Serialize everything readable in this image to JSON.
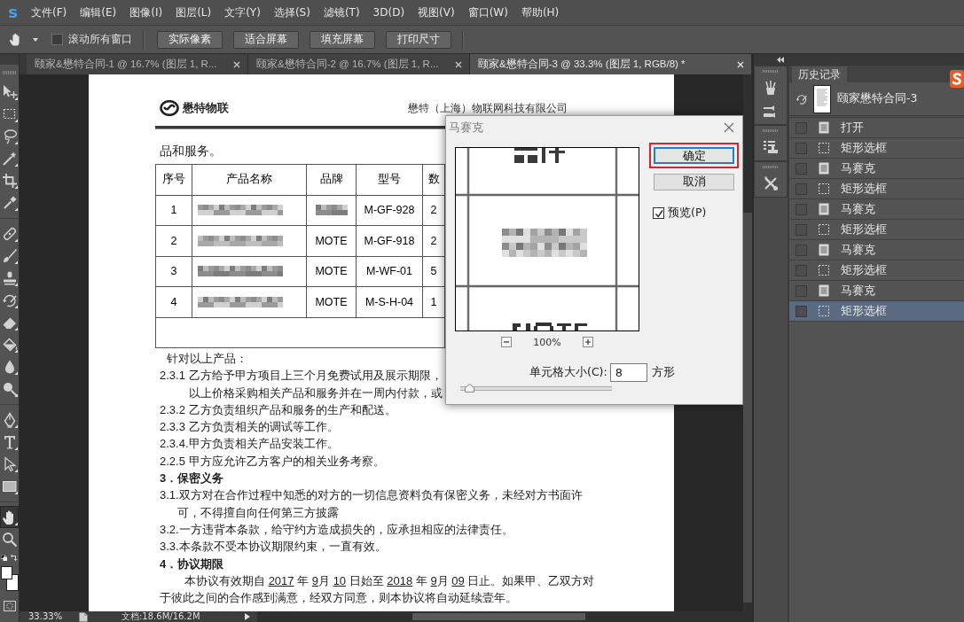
{
  "menu_bar": {
    "logo": "s",
    "items": [
      "文件(F)",
      "编辑(E)",
      "图像(I)",
      "图层(L)",
      "文字(Y)",
      "选择(S)",
      "滤镜(T)",
      "3D(D)",
      "视图(V)",
      "窗口(W)",
      "帮助(H)"
    ]
  },
  "options_bar": {
    "scroll_all": {
      "label": "滚动所有窗口",
      "checked": false
    },
    "buttons": [
      "实际像素",
      "适合屏幕",
      "填充屏幕",
      "打印尺寸"
    ]
  },
  "toolbar": {
    "tool_groups": [
      {
        "tools": [
          {
            "kind": "move",
            "selected": false
          },
          {
            "kind": "marquee",
            "selected": false
          },
          {
            "kind": "lasso",
            "selected": false
          },
          {
            "kind": "wand",
            "selected": false
          },
          {
            "kind": "crop",
            "selected": false
          },
          {
            "kind": "eyedropper",
            "selected": false
          }
        ]
      },
      {
        "tools": [
          {
            "kind": "healing",
            "selected": false
          },
          {
            "kind": "brush",
            "selected": false
          },
          {
            "kind": "stamp",
            "selected": false
          },
          {
            "kind": "history_brush",
            "selected": false
          },
          {
            "kind": "eraser",
            "selected": false
          },
          {
            "kind": "bucket",
            "selected": false
          },
          {
            "kind": "blur",
            "selected": false
          },
          {
            "kind": "dodge",
            "selected": false
          }
        ]
      },
      {
        "tools": [
          {
            "kind": "pen",
            "selected": false
          },
          {
            "kind": "type",
            "selected": false
          },
          {
            "kind": "path_select",
            "selected": false
          },
          {
            "kind": "rectangle",
            "selected": false
          }
        ]
      },
      {
        "tools": [
          {
            "kind": "hand",
            "selected": true
          },
          {
            "kind": "zoom",
            "selected": false
          }
        ]
      }
    ]
  },
  "document_tabs": [
    {
      "title": "颐家&懋特合同-1 @ 16.7% (图层 1, R...",
      "selected": false
    },
    {
      "title": "颐家&懋特合同-2 @ 16.7% (图层 1, R...",
      "selected": false
    },
    {
      "title": "颐家&懋特合同-3 @ 33.3% (图层 1, RGB/8) *",
      "selected": true
    }
  ],
  "document": {
    "header": {
      "brand": "懋特物联",
      "company": "懋特（上海）物联网科技有限公司"
    },
    "intro": "品和服务。",
    "table": {
      "columns": [
        "序号",
        "产品名称",
        "品牌",
        "型号",
        "数"
      ],
      "rows": [
        {
          "kind": "item",
          "no": "1",
          "brand_pixelated": true,
          "model": "M-GF-928",
          "quantity": "2"
        },
        {
          "kind": "item",
          "no": "2",
          "brand": "MOTE",
          "brand_pixelated": false,
          "model": "M-GF-918",
          "quantity": "2"
        },
        {
          "kind": "item",
          "no": "3",
          "brand": "MOTE",
          "brand_pixelated": false,
          "model": "M-WF-01",
          "quantity": "5"
        },
        {
          "kind": "item",
          "no": "4",
          "brand": "MOTE",
          "brand_pixelated": false,
          "model": "M-S-H-04",
          "quantity": "1"
        },
        {
          "kind": "blank"
        }
      ]
    },
    "paragraphs": [
      {
        "kind": "lead",
        "lines": [
          "针对以上产品："
        ]
      },
      {
        "kind": "item",
        "lines": [
          "2.3.1 乙方给予甲方项目上三个月免费试用及展示期限，",
          "以上价格采购相关产品和服务并在一周内付款，或"
        ]
      },
      {
        "kind": "item",
        "lines": [
          "2.3.2 乙方负责组织产品和服务的生产和配送。"
        ]
      },
      {
        "kind": "item",
        "lines": [
          "2.3.3 乙方负责相关的调试等工作。"
        ]
      },
      {
        "kind": "item",
        "lines": [
          "2.3.4.甲方负责相关产品安装工作。"
        ]
      },
      {
        "kind": "item",
        "lines": [
          "2.2.5 甲方应允许乙方客户的相关业务考察。"
        ]
      },
      {
        "kind": "heading",
        "lines": [
          "3．保密义务"
        ]
      },
      {
        "kind": "clause",
        "lines": [
          "3.1.双方对在合作过程中知悉的对方的一切信息资料负有保密义务，未经对方书面许",
          "可，不得擅自向任何第三方披露"
        ]
      },
      {
        "kind": "clause",
        "lines": [
          "3.2.一方违背本条款，给守约方造成损失的，应承担相应的法律责任。"
        ]
      },
      {
        "kind": "clause",
        "lines": [
          "3.3.本条款不受本协议期限约束，一直有效。"
        ]
      },
      {
        "kind": "heading",
        "lines": [
          "4．协议期限"
        ]
      },
      {
        "kind": "body",
        "lines": [
          {
            "segments": [
              {
                "text": "本协议有效期自 ",
                "underline": false
              },
              {
                "text": "2017",
                "underline": true
              },
              {
                "text": " 年 ",
                "underline": false
              },
              {
                "text": "9",
                "underline": true
              },
              {
                "text": "月 ",
                "underline": false
              },
              {
                "text": "10",
                "underline": true
              },
              {
                "text": " 日始至 ",
                "underline": false
              },
              {
                "text": "2018",
                "underline": true
              },
              {
                "text": " 年 ",
                "underline": false
              },
              {
                "text": "9",
                "underline": true
              },
              {
                "text": "月 ",
                "underline": false
              },
              {
                "text": "09",
                "underline": true
              },
              {
                "text": " 日止。如果甲、乙双方对",
                "underline": false
              }
            ]
          },
          "于彼此之间的合作感到满意，经双方同意，则本协议将自动延续壹年。"
        ]
      }
    ]
  },
  "mosaic_dialog": {
    "title": "马赛克",
    "buttons": [
      {
        "label": "确定",
        "default": true,
        "highlighted": true
      },
      {
        "label": "取消",
        "default": false,
        "highlighted": false
      }
    ],
    "preview": {
      "label": "预览(P)",
      "checked": true
    },
    "zoom": "100%",
    "cell_size": {
      "label": "单元格大小(C):",
      "value": "8",
      "unit": "方形",
      "level": 0.03
    }
  },
  "history_panel": {
    "tab": "历史记录",
    "snapshot": "颐家懋特合同-3",
    "steps": [
      {
        "kind": "document",
        "label": "打开",
        "selected": false
      },
      {
        "kind": "marquee",
        "label": "矩形选框",
        "selected": false
      },
      {
        "kind": "document",
        "label": "马赛克",
        "selected": false
      },
      {
        "kind": "marquee",
        "label": "矩形选框",
        "selected": false
      },
      {
        "kind": "document",
        "label": "马赛克",
        "selected": false
      },
      {
        "kind": "marquee",
        "label": "矩形选框",
        "selected": false
      },
      {
        "kind": "document",
        "label": "马赛克",
        "selected": false
      },
      {
        "kind": "marquee",
        "label": "矩形选框",
        "selected": false
      },
      {
        "kind": "document",
        "label": "马赛克",
        "selected": false
      },
      {
        "kind": "marquee",
        "label": "矩形选框",
        "selected": true
      }
    ]
  },
  "status_bar": {
    "zoom": "33.33%",
    "doc_info": "文档:18.6M/16.2M"
  }
}
